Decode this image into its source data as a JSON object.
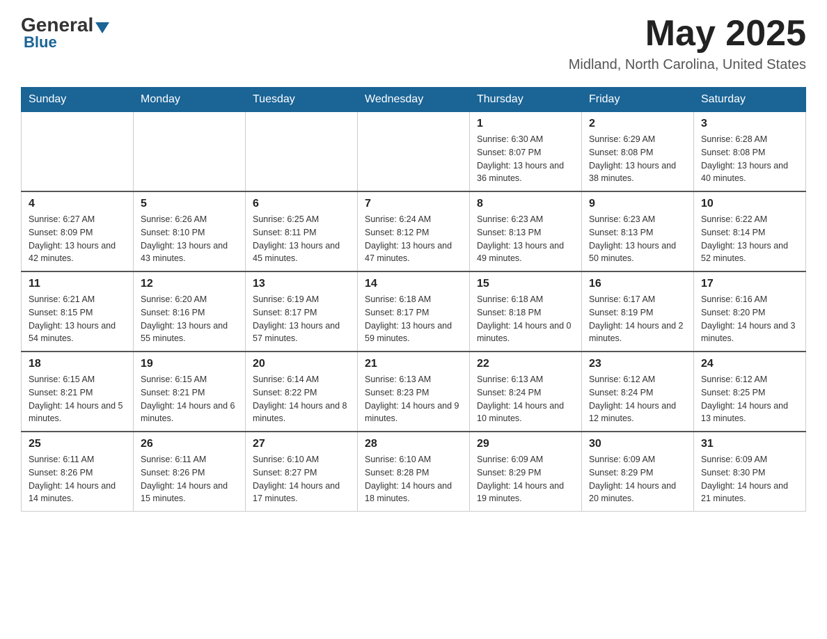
{
  "header": {
    "logo_general": "General",
    "logo_blue": "Blue",
    "month_year": "May 2025",
    "location": "Midland, North Carolina, United States"
  },
  "days_of_week": [
    "Sunday",
    "Monday",
    "Tuesday",
    "Wednesday",
    "Thursday",
    "Friday",
    "Saturday"
  ],
  "weeks": [
    [
      {
        "day": "",
        "sunrise": "",
        "sunset": "",
        "daylight": ""
      },
      {
        "day": "",
        "sunrise": "",
        "sunset": "",
        "daylight": ""
      },
      {
        "day": "",
        "sunrise": "",
        "sunset": "",
        "daylight": ""
      },
      {
        "day": "",
        "sunrise": "",
        "sunset": "",
        "daylight": ""
      },
      {
        "day": "1",
        "sunrise": "Sunrise: 6:30 AM",
        "sunset": "Sunset: 8:07 PM",
        "daylight": "Daylight: 13 hours and 36 minutes."
      },
      {
        "day": "2",
        "sunrise": "Sunrise: 6:29 AM",
        "sunset": "Sunset: 8:08 PM",
        "daylight": "Daylight: 13 hours and 38 minutes."
      },
      {
        "day": "3",
        "sunrise": "Sunrise: 6:28 AM",
        "sunset": "Sunset: 8:08 PM",
        "daylight": "Daylight: 13 hours and 40 minutes."
      }
    ],
    [
      {
        "day": "4",
        "sunrise": "Sunrise: 6:27 AM",
        "sunset": "Sunset: 8:09 PM",
        "daylight": "Daylight: 13 hours and 42 minutes."
      },
      {
        "day": "5",
        "sunrise": "Sunrise: 6:26 AM",
        "sunset": "Sunset: 8:10 PM",
        "daylight": "Daylight: 13 hours and 43 minutes."
      },
      {
        "day": "6",
        "sunrise": "Sunrise: 6:25 AM",
        "sunset": "Sunset: 8:11 PM",
        "daylight": "Daylight: 13 hours and 45 minutes."
      },
      {
        "day": "7",
        "sunrise": "Sunrise: 6:24 AM",
        "sunset": "Sunset: 8:12 PM",
        "daylight": "Daylight: 13 hours and 47 minutes."
      },
      {
        "day": "8",
        "sunrise": "Sunrise: 6:23 AM",
        "sunset": "Sunset: 8:13 PM",
        "daylight": "Daylight: 13 hours and 49 minutes."
      },
      {
        "day": "9",
        "sunrise": "Sunrise: 6:23 AM",
        "sunset": "Sunset: 8:13 PM",
        "daylight": "Daylight: 13 hours and 50 minutes."
      },
      {
        "day": "10",
        "sunrise": "Sunrise: 6:22 AM",
        "sunset": "Sunset: 8:14 PM",
        "daylight": "Daylight: 13 hours and 52 minutes."
      }
    ],
    [
      {
        "day": "11",
        "sunrise": "Sunrise: 6:21 AM",
        "sunset": "Sunset: 8:15 PM",
        "daylight": "Daylight: 13 hours and 54 minutes."
      },
      {
        "day": "12",
        "sunrise": "Sunrise: 6:20 AM",
        "sunset": "Sunset: 8:16 PM",
        "daylight": "Daylight: 13 hours and 55 minutes."
      },
      {
        "day": "13",
        "sunrise": "Sunrise: 6:19 AM",
        "sunset": "Sunset: 8:17 PM",
        "daylight": "Daylight: 13 hours and 57 minutes."
      },
      {
        "day": "14",
        "sunrise": "Sunrise: 6:18 AM",
        "sunset": "Sunset: 8:17 PM",
        "daylight": "Daylight: 13 hours and 59 minutes."
      },
      {
        "day": "15",
        "sunrise": "Sunrise: 6:18 AM",
        "sunset": "Sunset: 8:18 PM",
        "daylight": "Daylight: 14 hours and 0 minutes."
      },
      {
        "day": "16",
        "sunrise": "Sunrise: 6:17 AM",
        "sunset": "Sunset: 8:19 PM",
        "daylight": "Daylight: 14 hours and 2 minutes."
      },
      {
        "day": "17",
        "sunrise": "Sunrise: 6:16 AM",
        "sunset": "Sunset: 8:20 PM",
        "daylight": "Daylight: 14 hours and 3 minutes."
      }
    ],
    [
      {
        "day": "18",
        "sunrise": "Sunrise: 6:15 AM",
        "sunset": "Sunset: 8:21 PM",
        "daylight": "Daylight: 14 hours and 5 minutes."
      },
      {
        "day": "19",
        "sunrise": "Sunrise: 6:15 AM",
        "sunset": "Sunset: 8:21 PM",
        "daylight": "Daylight: 14 hours and 6 minutes."
      },
      {
        "day": "20",
        "sunrise": "Sunrise: 6:14 AM",
        "sunset": "Sunset: 8:22 PM",
        "daylight": "Daylight: 14 hours and 8 minutes."
      },
      {
        "day": "21",
        "sunrise": "Sunrise: 6:13 AM",
        "sunset": "Sunset: 8:23 PM",
        "daylight": "Daylight: 14 hours and 9 minutes."
      },
      {
        "day": "22",
        "sunrise": "Sunrise: 6:13 AM",
        "sunset": "Sunset: 8:24 PM",
        "daylight": "Daylight: 14 hours and 10 minutes."
      },
      {
        "day": "23",
        "sunrise": "Sunrise: 6:12 AM",
        "sunset": "Sunset: 8:24 PM",
        "daylight": "Daylight: 14 hours and 12 minutes."
      },
      {
        "day": "24",
        "sunrise": "Sunrise: 6:12 AM",
        "sunset": "Sunset: 8:25 PM",
        "daylight": "Daylight: 14 hours and 13 minutes."
      }
    ],
    [
      {
        "day": "25",
        "sunrise": "Sunrise: 6:11 AM",
        "sunset": "Sunset: 8:26 PM",
        "daylight": "Daylight: 14 hours and 14 minutes."
      },
      {
        "day": "26",
        "sunrise": "Sunrise: 6:11 AM",
        "sunset": "Sunset: 8:26 PM",
        "daylight": "Daylight: 14 hours and 15 minutes."
      },
      {
        "day": "27",
        "sunrise": "Sunrise: 6:10 AM",
        "sunset": "Sunset: 8:27 PM",
        "daylight": "Daylight: 14 hours and 17 minutes."
      },
      {
        "day": "28",
        "sunrise": "Sunrise: 6:10 AM",
        "sunset": "Sunset: 8:28 PM",
        "daylight": "Daylight: 14 hours and 18 minutes."
      },
      {
        "day": "29",
        "sunrise": "Sunrise: 6:09 AM",
        "sunset": "Sunset: 8:29 PM",
        "daylight": "Daylight: 14 hours and 19 minutes."
      },
      {
        "day": "30",
        "sunrise": "Sunrise: 6:09 AM",
        "sunset": "Sunset: 8:29 PM",
        "daylight": "Daylight: 14 hours and 20 minutes."
      },
      {
        "day": "31",
        "sunrise": "Sunrise: 6:09 AM",
        "sunset": "Sunset: 8:30 PM",
        "daylight": "Daylight: 14 hours and 21 minutes."
      }
    ]
  ]
}
